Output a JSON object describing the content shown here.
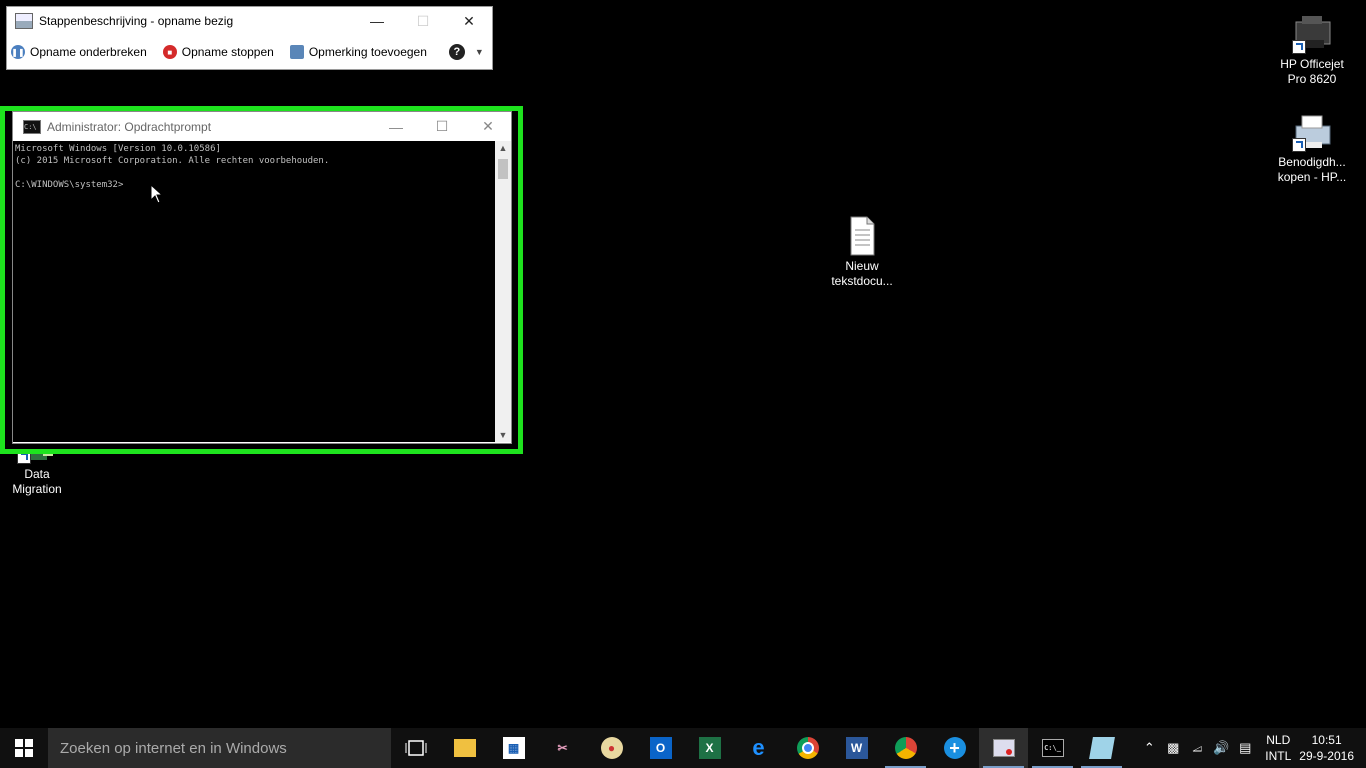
{
  "desktop": {
    "icons": [
      {
        "label_line1": "HP Officejet",
        "label_line2": "Pro 8620"
      },
      {
        "label_line1": "Benodigdh...",
        "label_line2": "kopen - HP..."
      },
      {
        "label_line1": "Nieuw",
        "label_line2": "tekstdocu..."
      },
      {
        "label_line1": "Data",
        "label_line2": "Migration"
      }
    ]
  },
  "steps_recorder": {
    "title": "Stappenbeschrijving - opname bezig",
    "pause_label": "Opname onderbreken",
    "stop_label": "Opname stoppen",
    "comment_label": "Opmerking toevoegen",
    "help": "?"
  },
  "cmd": {
    "title": "Administrator: Opdrachtprompt",
    "lines": [
      "Microsoft Windows [Version 10.0.10586]",
      "(c) 2015 Microsoft Corporation. Alle rechten voorbehouden.",
      "",
      "C:\\WINDOWS\\system32>"
    ]
  },
  "taskbar": {
    "search_placeholder": "Zoeken op internet en in Windows",
    "apps": [
      "task-view",
      "file-explorer",
      "store",
      "snipping-tool",
      "paint",
      "outlook",
      "excel",
      "edge",
      "chrome",
      "word",
      "chrome-user",
      "add-app",
      "steps-recorder",
      "command-prompt",
      "notepad"
    ],
    "language_line1": "NLD",
    "language_line2": "INTL",
    "time": "10:51",
    "date": "29-9-2016"
  },
  "colors": {
    "highlight": "#1ee31e",
    "desktop": "#000000",
    "taskbar": "#101010"
  }
}
